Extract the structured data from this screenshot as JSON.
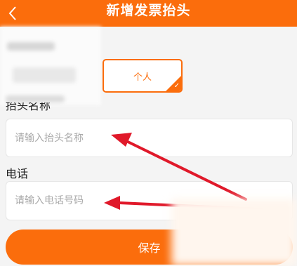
{
  "header": {
    "title": "新增发票抬头",
    "back_icon": "chevron-left-icon"
  },
  "invoice_type": {
    "selected_option": "个人"
  },
  "form": {
    "name_label": "抬头名称",
    "name_placeholder": "请输入抬头名称",
    "phone_label": "电话",
    "phone_placeholder": "请输入电话号码"
  },
  "save_button": {
    "label": "保存"
  },
  "colors": {
    "accent": "#fb6d0c",
    "annotation_arrow": "#e0192a"
  }
}
